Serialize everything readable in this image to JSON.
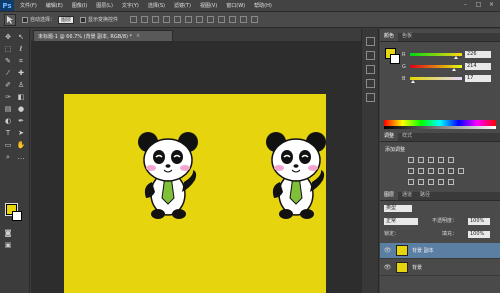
{
  "app": {
    "logo": "Ps"
  },
  "menu": [
    "文件(F)",
    "编辑(E)",
    "图像(I)",
    "图层(L)",
    "文字(Y)",
    "选择(S)",
    "滤镜(T)",
    "视图(V)",
    "窗口(W)",
    "帮助(H)"
  ],
  "window_controls": [
    "–",
    "□",
    "×"
  ],
  "options_bar": {
    "auto_select_label": "自动选择：",
    "auto_select_value": "图层",
    "show_transform_label": "显示变换控件"
  },
  "document": {
    "tab_title": "未标题-1 @ 66.7% (背景 副本, RGB/8) *",
    "close": "×",
    "canvas_color": "#e6d40f"
  },
  "colors": {
    "foreground": "#e7d50d",
    "background": "#ffffff"
  },
  "color_panel": {
    "tabs": [
      "颜色",
      "色板"
    ],
    "sliders": [
      {
        "label": "R",
        "value": "226",
        "fraction": 0.886
      },
      {
        "label": "G",
        "value": "214",
        "fraction": 0.839
      },
      {
        "label": "B",
        "value": "17",
        "fraction": 0.067
      }
    ]
  },
  "adjust_panel": {
    "tabs": [
      "调整",
      "样式"
    ],
    "title": "添加调整"
  },
  "layers_panel": {
    "tabs": [
      "图层",
      "通道",
      "路径"
    ],
    "kind_label": "类型",
    "blend_mode": "正常",
    "opacity_label": "不透明度：",
    "opacity_value": "100%",
    "lock_label": "锁定：",
    "fill_label": "填充：",
    "fill_value": "100%",
    "layers": [
      {
        "name": "背景 副本",
        "selected": true
      },
      {
        "name": "背景",
        "selected": false
      }
    ]
  }
}
